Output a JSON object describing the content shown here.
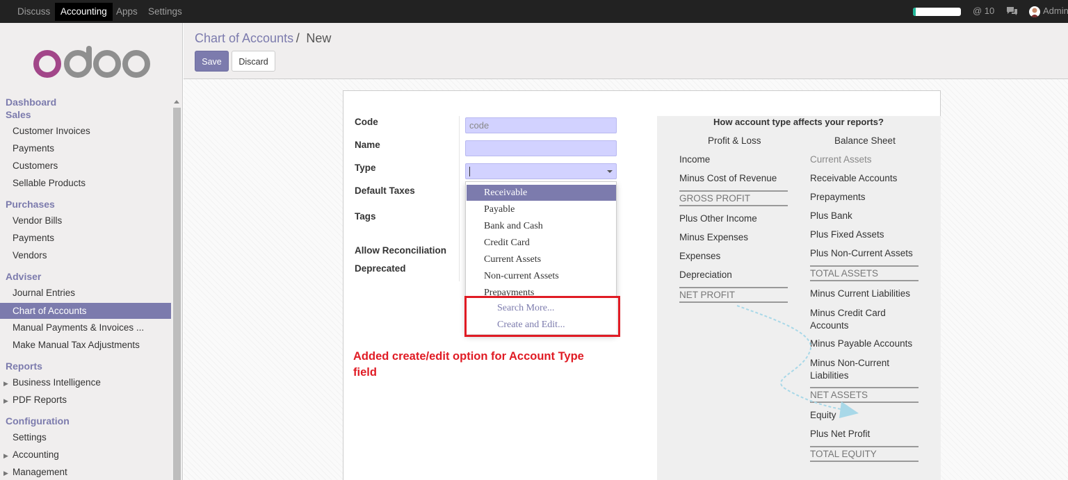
{
  "topbar": {
    "menus": [
      "Discuss",
      "Accounting",
      "Apps",
      "Settings"
    ],
    "active_menu": "Accounting",
    "messages_count": "@ 10",
    "user": "Admin"
  },
  "sidebar": {
    "logo_text": "odoo",
    "sections": {
      "dashboard": "Dashboard",
      "sales": "Sales",
      "purchases": "Purchases",
      "adviser": "Adviser",
      "reports": "Reports",
      "configuration": "Configuration"
    },
    "sales_items": [
      "Customer Invoices",
      "Payments",
      "Customers",
      "Sellable Products"
    ],
    "purchases_items": [
      "Vendor Bills",
      "Payments",
      "Vendors"
    ],
    "adviser_items": [
      "Journal Entries",
      "Chart of Accounts",
      "Manual Payments & Invoices ...",
      "Make Manual Tax Adjustments"
    ],
    "reports_items": [
      "Business Intelligence",
      "PDF Reports"
    ],
    "configuration_items": [
      "Settings",
      "Accounting",
      "Management"
    ]
  },
  "control": {
    "breadcrumb_parent": "Chart of Accounts",
    "breadcrumb_sep": "/",
    "breadcrumb_current": "New",
    "save_label": "Save",
    "discard_label": "Discard"
  },
  "form": {
    "code_label": "Code",
    "code_placeholder": "code",
    "name_label": "Name",
    "type_label": "Type",
    "default_taxes_label": "Default Taxes",
    "tags_label": "Tags",
    "allow_reconciliation_label": "Allow Reconciliation",
    "deprecated_label": "Deprecated",
    "type_options": [
      "Receivable",
      "Payable",
      "Bank and Cash",
      "Credit Card",
      "Current Assets",
      "Non-current Assets",
      "Prepayments"
    ],
    "selected_option": "Receivable",
    "search_more": "Search More...",
    "create_and_edit": "Create and Edit..."
  },
  "annotation": "Added create/edit option for Account Type field",
  "help": {
    "title": "How account type affects your reports?",
    "pl_header": "Profit & Loss",
    "bs_header": "Balance Sheet",
    "pl_items": [
      "Income",
      "Minus Cost of Revenue",
      "GROSS PROFIT",
      "Plus Other Income",
      "Minus Expenses",
      "Expenses",
      "Depreciation",
      "NET PROFIT"
    ],
    "bs_items": [
      "Current Assets",
      "Receivable Accounts",
      "Prepayments",
      "Plus Bank",
      "Plus Fixed Assets",
      "Plus Non-Current Assets",
      "TOTAL ASSETS",
      "Minus Current Liabilities",
      "Minus Credit Card Accounts",
      "Minus Payable Accounts",
      "Minus Non-Current Liabilities",
      "NET ASSETS",
      "Equity",
      "Plus Net Profit",
      "TOTAL EQUITY"
    ]
  }
}
